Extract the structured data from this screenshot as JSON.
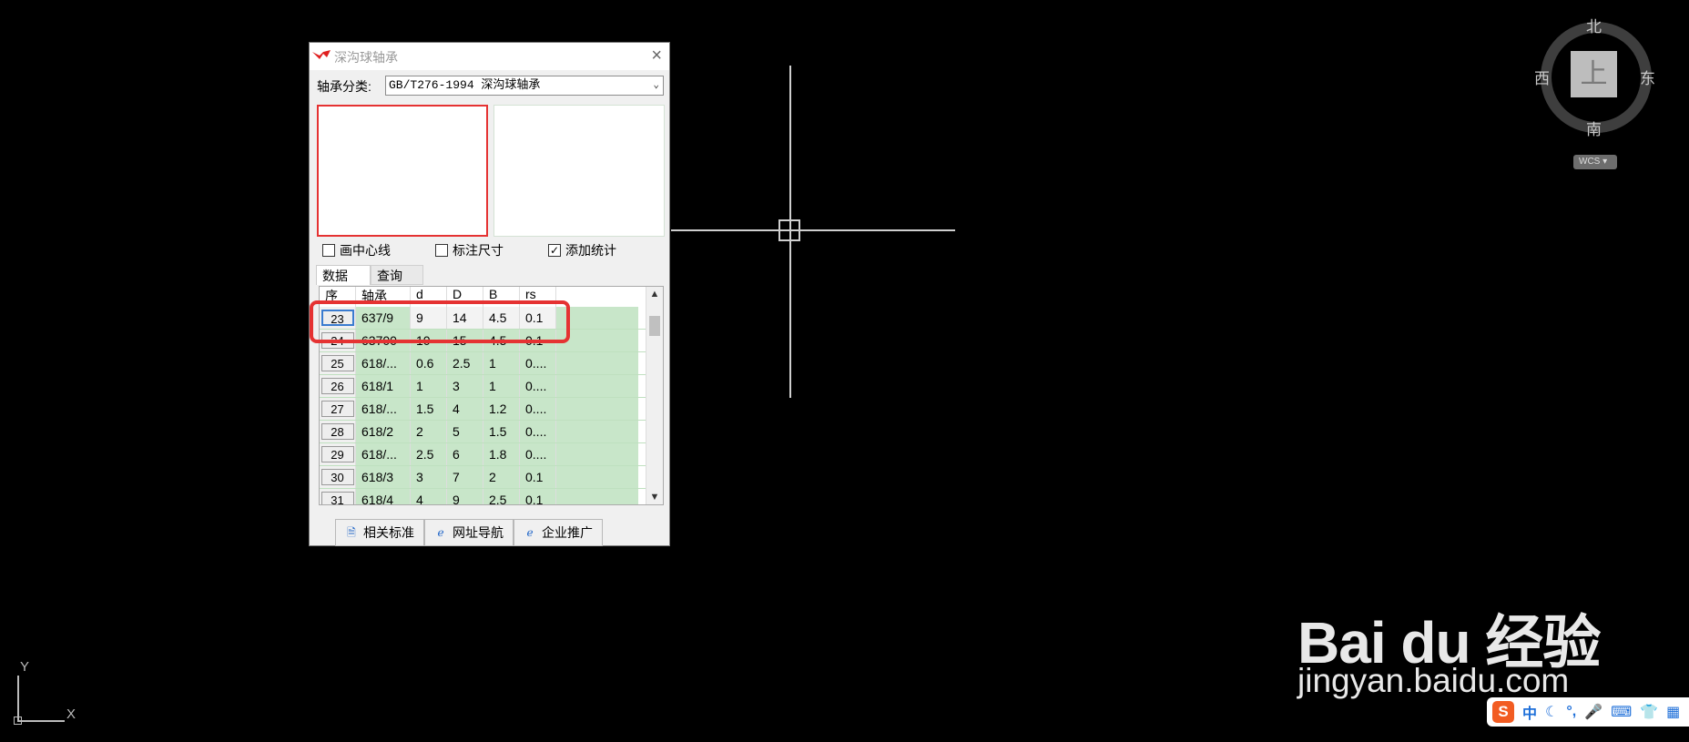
{
  "dialog": {
    "title": "深沟球轴承",
    "category_label": "轴承分类:",
    "category_value": "GB/T276-1994 深沟球轴承",
    "checkboxes": [
      {
        "label": "画中心线",
        "checked": false
      },
      {
        "label": "标注尺寸",
        "checked": false
      },
      {
        "label": "添加统计",
        "checked": true
      }
    ],
    "tabs": [
      "数据",
      "查询"
    ],
    "columns": [
      "序",
      "轴承",
      "d",
      "D",
      "B",
      "rs"
    ],
    "rows": [
      {
        "n": "23",
        "bearing": "637/9",
        "d": "9",
        "D": "14",
        "B": "4.5",
        "rs": "0.1"
      },
      {
        "n": "24",
        "bearing": "63700",
        "d": "10",
        "D": "15",
        "B": "4.5",
        "rs": "0.1"
      },
      {
        "n": "25",
        "bearing": "618/...",
        "d": "0.6",
        "D": "2.5",
        "B": "1",
        "rs": "0...."
      },
      {
        "n": "26",
        "bearing": "618/1",
        "d": "1",
        "D": "3",
        "B": "1",
        "rs": "0...."
      },
      {
        "n": "27",
        "bearing": "618/...",
        "d": "1.5",
        "D": "4",
        "B": "1.2",
        "rs": "0...."
      },
      {
        "n": "28",
        "bearing": "618/2",
        "d": "2",
        "D": "5",
        "B": "1.5",
        "rs": "0...."
      },
      {
        "n": "29",
        "bearing": "618/...",
        "d": "2.5",
        "D": "6",
        "B": "1.8",
        "rs": "0...."
      },
      {
        "n": "30",
        "bearing": "618/3",
        "d": "3",
        "D": "7",
        "B": "2",
        "rs": "0.1"
      },
      {
        "n": "31",
        "bearing": "618/4",
        "d": "4",
        "D": "9",
        "B": "2.5",
        "rs": "0.1"
      }
    ],
    "buttons": [
      "相关标准",
      "网址导航",
      "企业推广"
    ]
  },
  "viewcube": {
    "top": "上",
    "north": "北",
    "south": "南",
    "east": "东",
    "west": "西",
    "wcs": "WCS"
  },
  "ucs": {
    "x": "X",
    "y": "Y"
  },
  "watermark": {
    "brand": "Bai du 经验",
    "url": "jingyan.baidu.com"
  },
  "ime": {
    "logo": "S",
    "mode": "中"
  }
}
